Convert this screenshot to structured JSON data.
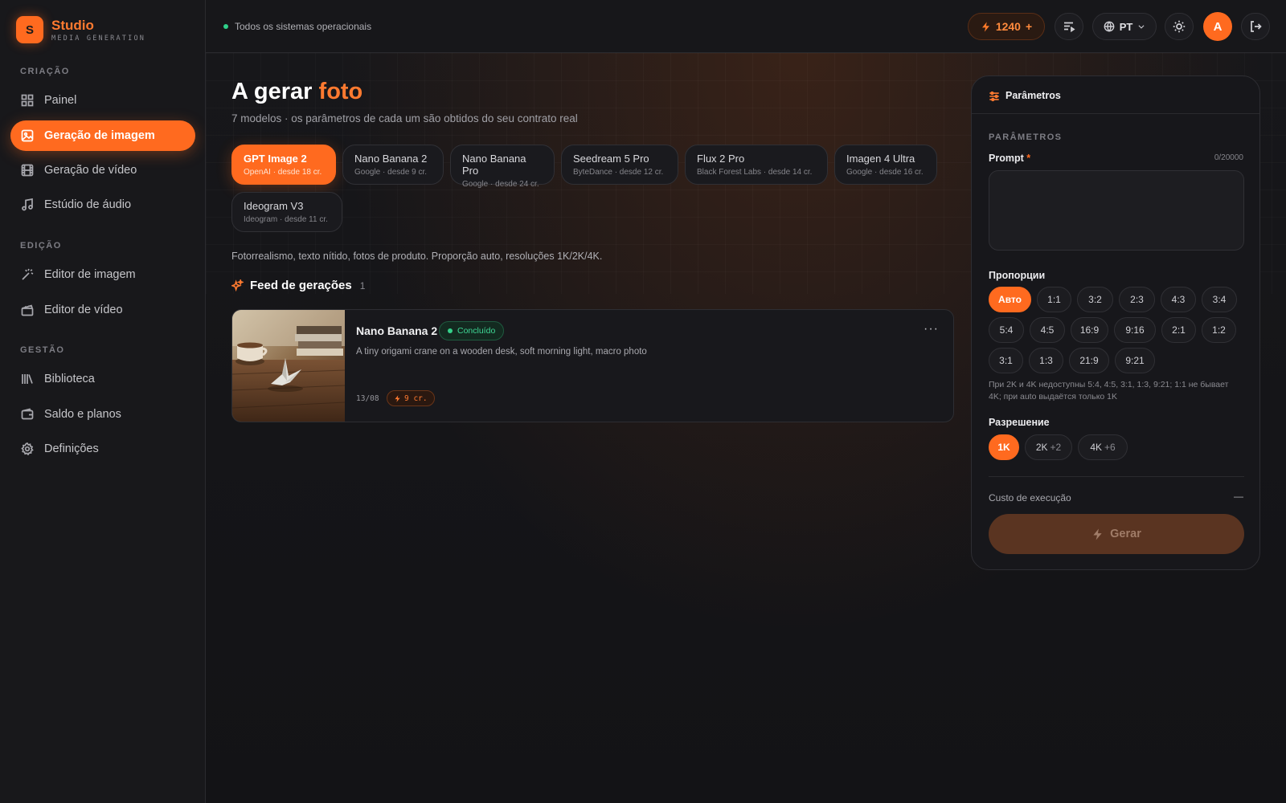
{
  "brand": {
    "logo_letter": "S",
    "name": "Studio",
    "subtitle": "MEDIA GENERATION"
  },
  "sidebar": {
    "sections": [
      {
        "title": "CRIAÇÃO",
        "items": [
          {
            "label": "Painel",
            "icon": "dashboard-icon"
          },
          {
            "label": "Geração de imagem",
            "icon": "image-icon",
            "active": true
          },
          {
            "label": "Geração de vídeo",
            "icon": "film-icon"
          },
          {
            "label": "Estúdio de áudio",
            "icon": "music-icon"
          }
        ]
      },
      {
        "title": "EDIÇÃO",
        "items": [
          {
            "label": "Editor de imagem",
            "icon": "magic-wand-icon"
          },
          {
            "label": "Editor de vídeo",
            "icon": "clapperboard-icon"
          }
        ]
      },
      {
        "title": "GESTÃO",
        "items": [
          {
            "label": "Biblioteca",
            "icon": "library-icon"
          },
          {
            "label": "Saldo e planos",
            "icon": "wallet-icon"
          },
          {
            "label": "Definições",
            "icon": "gear-icon"
          }
        ]
      }
    ]
  },
  "topbar": {
    "status_text": "Todos os sistemas operacionais",
    "credits": "1240",
    "credits_plus": "+",
    "language": "PT",
    "avatar_letter": "A"
  },
  "page": {
    "title_prefix": "A gerar",
    "title_accent": "foto",
    "subtitle": "7 modelos · os parâmetros de cada um são obtidos do seu contrato real",
    "models": [
      {
        "name": "GPT Image 2",
        "meta": "OpenAI · desde 18 cr.",
        "active": true
      },
      {
        "name": "Nano Banana 2",
        "meta": "Google · desde 9 cr."
      },
      {
        "name": "Nano Banana Pro",
        "meta": "Google · desde 24 cr."
      },
      {
        "name": "Seedream 5 Pro",
        "meta": "ByteDance · desde 12 cr."
      },
      {
        "name": "Flux 2 Pro",
        "meta": "Black Forest Labs · desde 14 cr."
      },
      {
        "name": "Imagen 4 Ultra",
        "meta": "Google · desde 16 cr."
      },
      {
        "name": "Ideogram V3",
        "meta": "Ideogram · desde 11 cr."
      }
    ],
    "model_description": "Fotorrealismo, texto nítido, fotos de produto. Proporção auto, resoluções 1K/2K/4K."
  },
  "feed": {
    "title": "Feed de gerações",
    "count": "1",
    "items": [
      {
        "model": "Nano Banana 2",
        "status": "Concluído",
        "prompt": "A tiny origami crane on a wooden desk, soft morning light, macro photo",
        "date": "13/08",
        "cost": "9 cr.",
        "more": "···"
      }
    ]
  },
  "panel": {
    "header": "Parâmetros",
    "section_title": "PARÂMETROS",
    "prompt_label": "Prompt",
    "prompt_required": "*",
    "prompt_counter": "0/20000",
    "prompt_value": "",
    "ratio_label": "Пропорции",
    "ratios": [
      "Авто",
      "1:1",
      "3:2",
      "2:3",
      "4:3",
      "3:4",
      "5:4",
      "4:5",
      "16:9",
      "9:16",
      "2:1",
      "1:2",
      "3:1",
      "1:3",
      "21:9",
      "9:21"
    ],
    "ratio_selected": "Авто",
    "ratio_note": "При 2K и 4K недоступны 5:4, 4:5, 3:1, 1:3, 9:21; 1:1 не бывает 4K; при auto выдаётся только 1K",
    "resolution_label": "Разрешение",
    "resolutions": [
      {
        "label": "1K",
        "extra": "",
        "active": true
      },
      {
        "label": "2K",
        "extra": "+2"
      },
      {
        "label": "4K",
        "extra": "+6"
      }
    ],
    "cost_label": "Custo de execução",
    "cost_value": "—",
    "generate_label": "Gerar"
  },
  "colors": {
    "accent": "#ff6a1f",
    "success": "#35d08a",
    "background": "#131316"
  }
}
